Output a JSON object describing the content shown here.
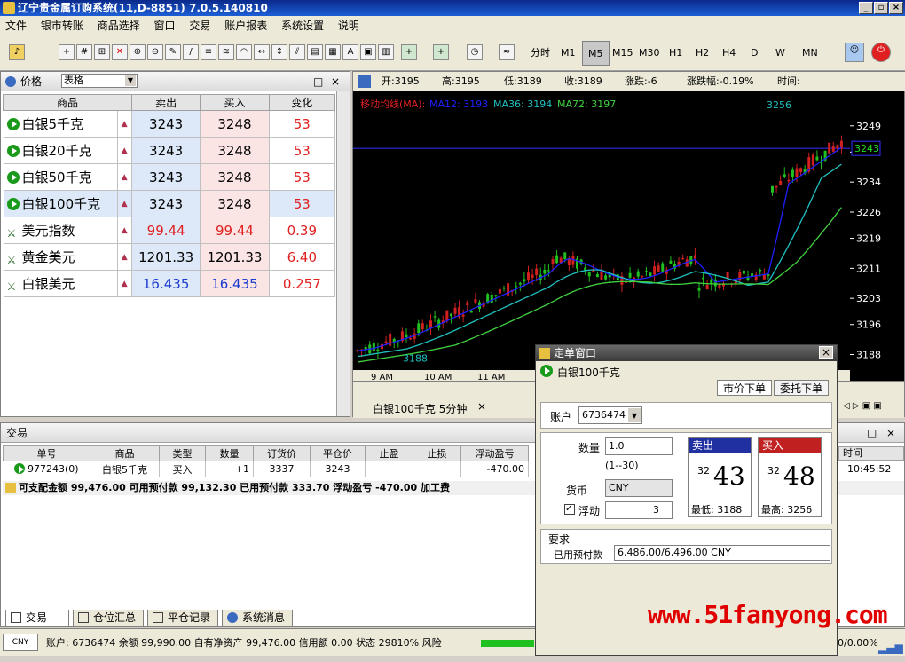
{
  "window": {
    "title": "辽宁贵金属订购系统(11,D-8851) 7.0.5.140810"
  },
  "menu": [
    "文件",
    "银市转账",
    "商品选择",
    "窗口",
    "交易",
    "账户报表",
    "系统设置",
    "说明"
  ],
  "timeframes": [
    "分时",
    "M1",
    "M5",
    "M15",
    "M30",
    "H1",
    "H2",
    "H4",
    "D",
    "W",
    "MN"
  ],
  "selected_timeframe": "M5",
  "price_panel": {
    "title": "价格",
    "view_select": "表格",
    "headers": [
      "商品",
      "卖出",
      "买入",
      "变化"
    ],
    "rows": [
      {
        "name": "白银5千克",
        "sell": "3243",
        "buy": "3248",
        "change": "53",
        "icon": "play-icon"
      },
      {
        "name": "白银20千克",
        "sell": "3243",
        "buy": "3248",
        "change": "53",
        "icon": "play-icon"
      },
      {
        "name": "白银50千克",
        "sell": "3243",
        "buy": "3248",
        "change": "53",
        "icon": "play-icon"
      },
      {
        "name": "白银100千克",
        "sell": "3243",
        "buy": "3248",
        "change": "53",
        "icon": "play-icon"
      },
      {
        "name": "美元指数",
        "sell": "99.44",
        "buy": "99.44",
        "change": "0.39",
        "icon": "sword-icon"
      },
      {
        "name": "黄金美元",
        "sell": "1201.33",
        "buy": "1201.33",
        "change": "6.40",
        "icon": "sword-icon"
      },
      {
        "name": "白银美元",
        "sell": "16.435",
        "buy": "16.435",
        "change": "0.257",
        "icon": "sword-icon"
      }
    ]
  },
  "chart_info": {
    "open": "开:3195",
    "high": "高:3195",
    "low": "低:3189",
    "close": "收:3189",
    "change": "涨跌:-6",
    "change_pct": "涨跌幅:-0.19%",
    "time": "时间:"
  },
  "chart_data": {
    "type": "line",
    "legend": "移动均线(MA):",
    "series": [
      {
        "name": "MA12: 3193",
        "color": "#2020ff"
      },
      {
        "name": "MA36: 3194",
        "color": "#20c0c0"
      },
      {
        "name": "MA72: 3197",
        "color": "#40d040"
      }
    ],
    "yticks": [
      3249,
      3242,
      3234,
      3226,
      3219,
      3211,
      3203,
      3196,
      3188
    ],
    "current_price": "3243",
    "high_label": "3256",
    "low_label": "3188",
    "xticks": [
      "9 AM",
      "10 AM",
      "11 AM"
    ],
    "ylim": [
      3186,
      3257
    ]
  },
  "chart_tab": "白银100千克 5分钟",
  "trade_panel": {
    "title": "交易",
    "headers": [
      "单号",
      "商品",
      "类型",
      "数量",
      "订货价",
      "平仓价",
      "止盈",
      "止损",
      "浮动盈亏"
    ],
    "row": {
      "id": "977243(0)",
      "product": "白银5千克",
      "type": "买入",
      "qty": "+1",
      "order_price": "3337",
      "close_price": "3243",
      "tp": "",
      "sl": "",
      "pl": "-470.00"
    },
    "time_header": "时间",
    "time_value": "10:45:52",
    "summary": "可支配金额 99,476.00   可用预付款 99,132.30   已用预付款 333.70   浮动盈亏 -470.00   加工费"
  },
  "bottom_tabs": [
    "交易",
    "仓位汇总",
    "平仓记录",
    "系统消息"
  ],
  "status": {
    "currency": "CNY",
    "text": "账户: 6736474 余额 99,990.00 自有净资产 99,476.00 信用额 0.00 状态 29810% 风险",
    "right": "0/0.00%"
  },
  "order_window": {
    "title": "定单窗口",
    "product": "白银100千克",
    "tabs": [
      "市价下单",
      "委托下单"
    ],
    "account_label": "账户",
    "account": "6736474",
    "qty_label": "数量",
    "qty": "1.0",
    "qty_range": "(1--30)",
    "currency_label": "货币",
    "currency": "CNY",
    "float_label": "浮动",
    "float_value": "3",
    "sell_label": "卖出",
    "sell_small": "32",
    "sell_big": "43",
    "sell_low": "最低: 3188",
    "buy_label": "买入",
    "buy_small": "32",
    "buy_big": "48",
    "buy_high": "最高: 3256",
    "req_label": "要求",
    "used_label": "已用预付款",
    "used_value": "6,486.00/6,496.00 CNY"
  },
  "watermark": "www.51fanyong.com"
}
